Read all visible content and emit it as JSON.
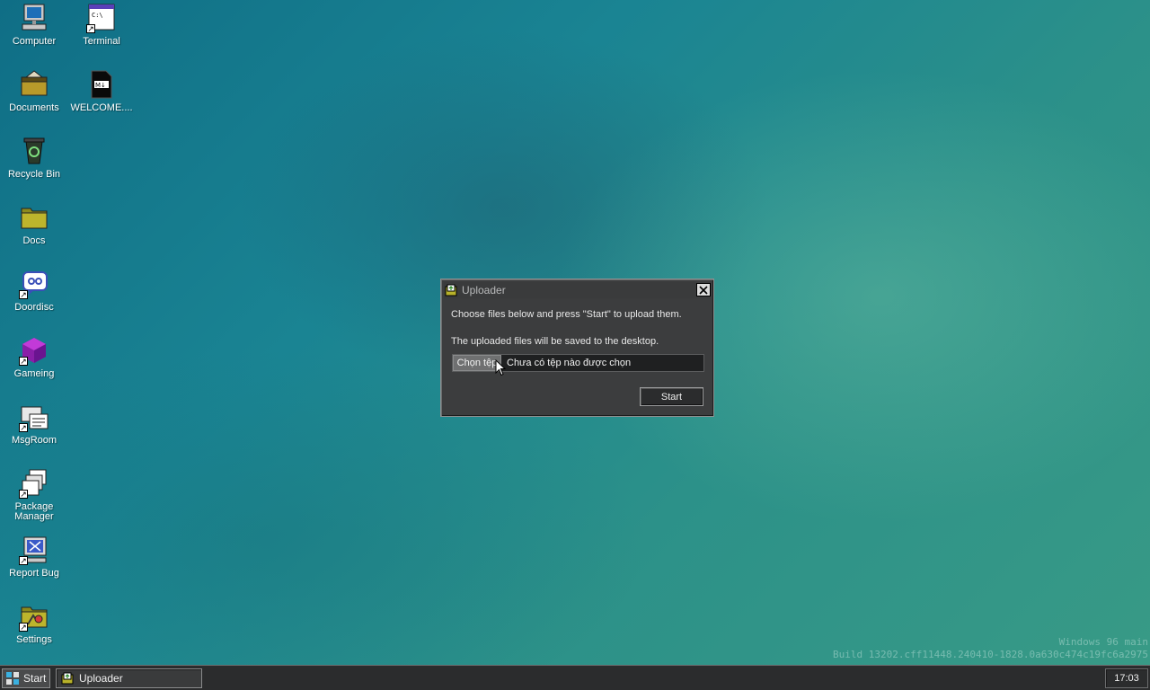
{
  "desktop": {
    "icons": [
      {
        "label": "Computer",
        "icon": "computer-icon"
      },
      {
        "label": "Terminal",
        "icon": "terminal-icon"
      },
      {
        "label": "Documents",
        "icon": "documents-folder-icon"
      },
      {
        "label": "WELCOME....",
        "icon": "markdown-file-icon"
      },
      {
        "label": "Recycle Bin",
        "icon": "recycle-bin-icon"
      },
      {
        "label": "Docs",
        "icon": "folder-icon"
      },
      {
        "label": "Doordisc",
        "icon": "doordisc-icon"
      },
      {
        "label": "Gameing",
        "icon": "game-cube-icon"
      },
      {
        "label": "MsgRoom",
        "icon": "msgroom-icon"
      },
      {
        "label": "Package Manager",
        "icon": "package-manager-icon"
      },
      {
        "label": "Report Bug",
        "icon": "report-bug-icon"
      },
      {
        "label": "Settings",
        "icon": "settings-icon"
      }
    ],
    "watermark": {
      "line1": "Windows 96 main",
      "line2": "Build 13202.cff11448.240410-1828.0a630c474c19fc6a2975"
    }
  },
  "dialog": {
    "title": "Uploader",
    "line1": "Choose files below and press \"Start\" to upload them.",
    "line2": "The uploaded files will be saved to the desktop.",
    "file_input": {
      "button_label": "Chọn tệp",
      "status_text": "Chưa có tệp nào được chọn"
    },
    "start_label": "Start"
  },
  "taskbar": {
    "start_label": "Start",
    "tasks": [
      {
        "label": "Uploader",
        "icon": "uploader-app-icon"
      }
    ],
    "clock": "17:03"
  },
  "colors": {
    "dialog_bg": "#3c3d3e",
    "taskbar_bg": "#2b2c2d",
    "desktop_teal": "#1a8493"
  }
}
